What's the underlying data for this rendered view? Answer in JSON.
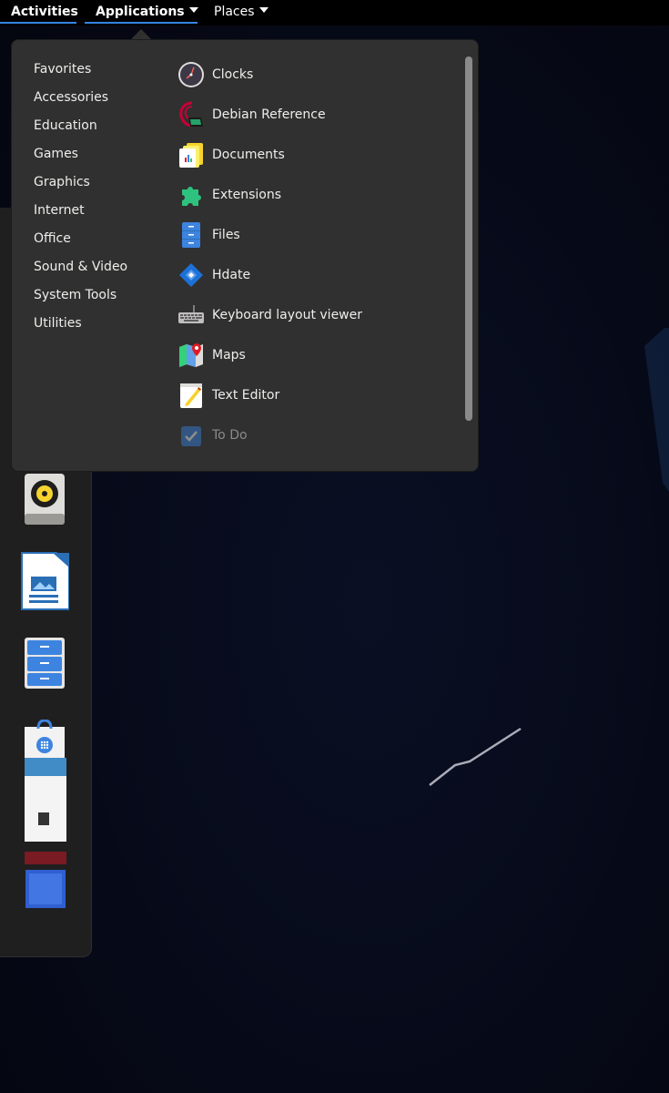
{
  "topbar": {
    "activities": "Activities",
    "applications": "Applications",
    "places": "Places"
  },
  "menu": {
    "categories": [
      "Favorites",
      "Accessories",
      "Education",
      "Games",
      "Graphics",
      "Internet",
      "Office",
      "Sound & Video",
      "System Tools",
      "Utilities"
    ],
    "apps": [
      {
        "label": "Clocks",
        "icon": "clock-icon"
      },
      {
        "label": "Debian Reference",
        "icon": "debian-reference-icon"
      },
      {
        "label": "Documents",
        "icon": "documents-icon"
      },
      {
        "label": "Extensions",
        "icon": "extensions-icon"
      },
      {
        "label": "Files",
        "icon": "files-icon"
      },
      {
        "label": "Hdate",
        "icon": "hdate-icon"
      },
      {
        "label": "Keyboard layout viewer",
        "icon": "keyboard-icon"
      },
      {
        "label": "Maps",
        "icon": "maps-icon"
      },
      {
        "label": "Text Editor",
        "icon": "text-editor-icon"
      },
      {
        "label": "To Do",
        "icon": "todo-icon"
      }
    ]
  },
  "dock": {
    "apps": [
      "rhythmbox-icon",
      "libreoffice-writer-icon",
      "files-icon",
      "software-icon",
      "partial-icon",
      "partial-icon"
    ]
  },
  "colors": {
    "accent": "#3584e4",
    "menu_bg": "#303030",
    "topbar": "#000000"
  }
}
